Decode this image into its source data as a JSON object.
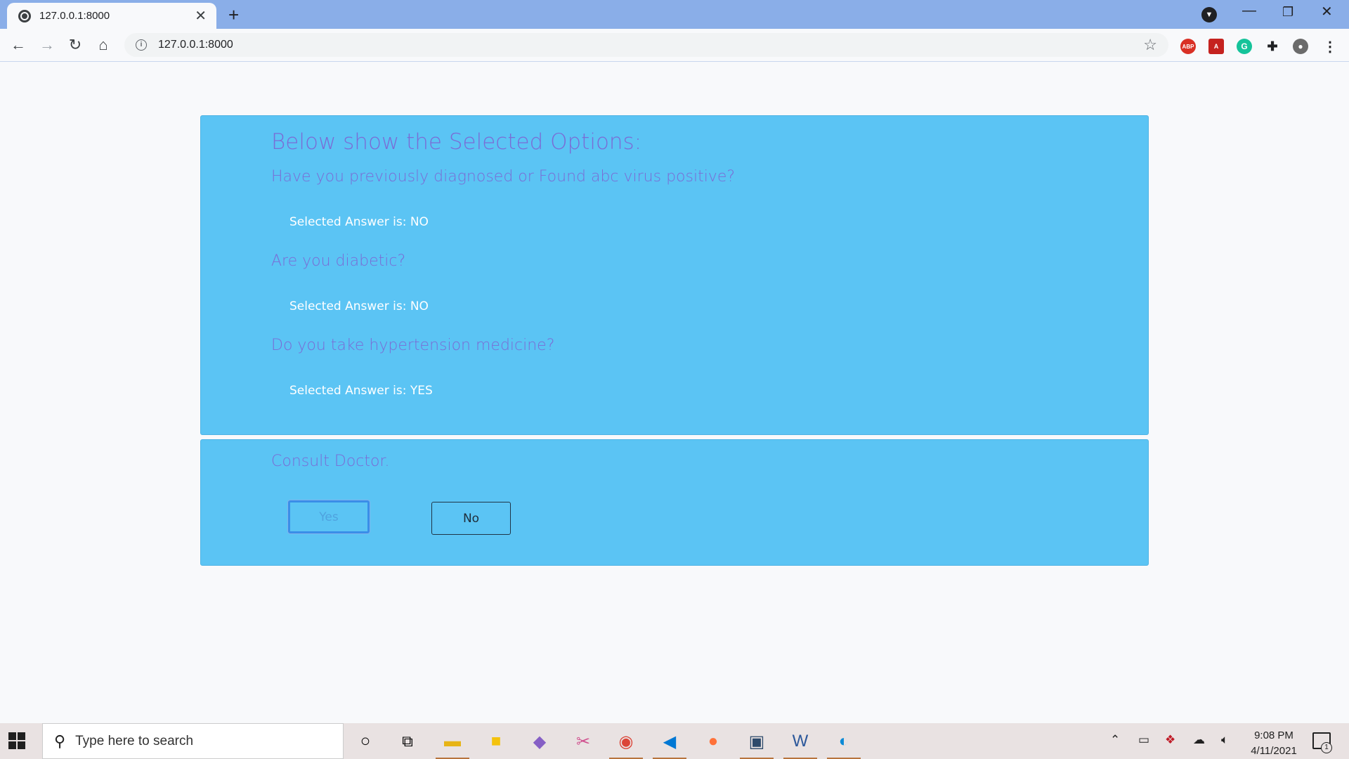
{
  "browser": {
    "tab_title": "127.0.0.1:8000",
    "url": "127.0.0.1:8000",
    "extensions": [
      "adblock-plus",
      "acrobat",
      "grammarly",
      "extensions-puzzle",
      "profile-avatar"
    ]
  },
  "page": {
    "selected_heading": "Below show the Selected Options:",
    "questions": [
      {
        "question": "Have you previously diagnosed or Found abc virus positive?",
        "answer": "Selected Answer is: NO"
      },
      {
        "question": "Are you diabetic?",
        "answer": "Selected Answer is: NO"
      },
      {
        "question": "Do you take hypertension medicine?",
        "answer": "Selected Answer is: YES"
      }
    ],
    "result_heading": "Consult Doctor.",
    "yes_label": "Yes",
    "no_label": "No",
    "colors": {
      "card": "#5bc4f4",
      "heading": "#7a6cd6",
      "answer": "#ffffff"
    }
  },
  "taskbar": {
    "search_placeholder": "Type here to search",
    "time": "9:08 PM",
    "date": "4/11/2021",
    "notification_count": "1",
    "apps": [
      "cortana-icon",
      "task-view-icon",
      "file-explorer-icon",
      "sticky-notes-icon",
      "visual-studio-icon",
      "snip-icon",
      "chrome-icon",
      "vscode-icon",
      "firefox-icon",
      "mysql-workbench-icon",
      "word-icon",
      "edge-icon"
    ]
  }
}
